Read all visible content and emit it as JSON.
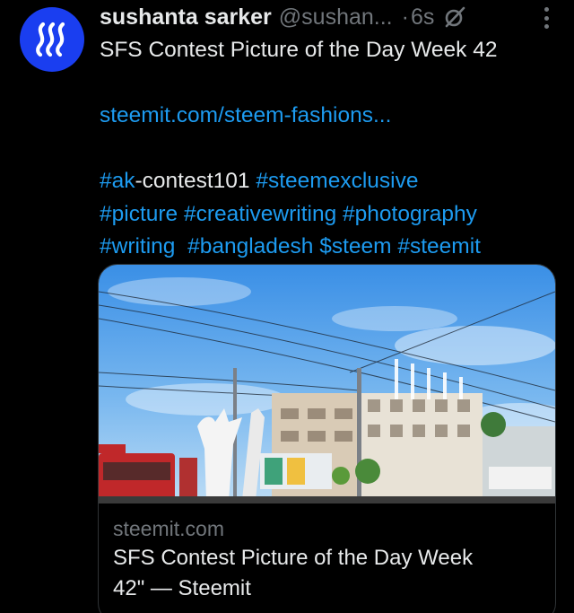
{
  "author": {
    "display_name": "sushanta sarker",
    "handle": "@sushan...",
    "time_separator": "·",
    "time": "6s",
    "avatar_color": "#1a3ef0",
    "avatar_icon": "steem-logo-icon"
  },
  "header_icons": [
    "grok-slash-icon",
    "more-vertical-icon"
  ],
  "tweet": {
    "line1": "SFS Contest Picture of the Day Week 42",
    "link": "steemit.com/steem-fashions...",
    "tags_line1": {
      "tag1": "#ak",
      "plain": "-contest101 ",
      "tag2": "#steemexclusive"
    },
    "tags_line2": [
      "#picture",
      "#creativewriting",
      "#photography"
    ],
    "tags_line3": [
      "#writing",
      "#bangladesh",
      "$steem",
      "#steemit"
    ]
  },
  "card": {
    "domain": "steemit.com",
    "title_line1": "SFS Contest Picture of the Day Week",
    "title_line2": "42\" — Steemit",
    "image_description_icon": "street-photo-image"
  },
  "colors": {
    "background": "#000000",
    "text": "#e7e9ea",
    "muted": "#71767b",
    "link": "#1d9bf0",
    "border": "#2f3336"
  }
}
